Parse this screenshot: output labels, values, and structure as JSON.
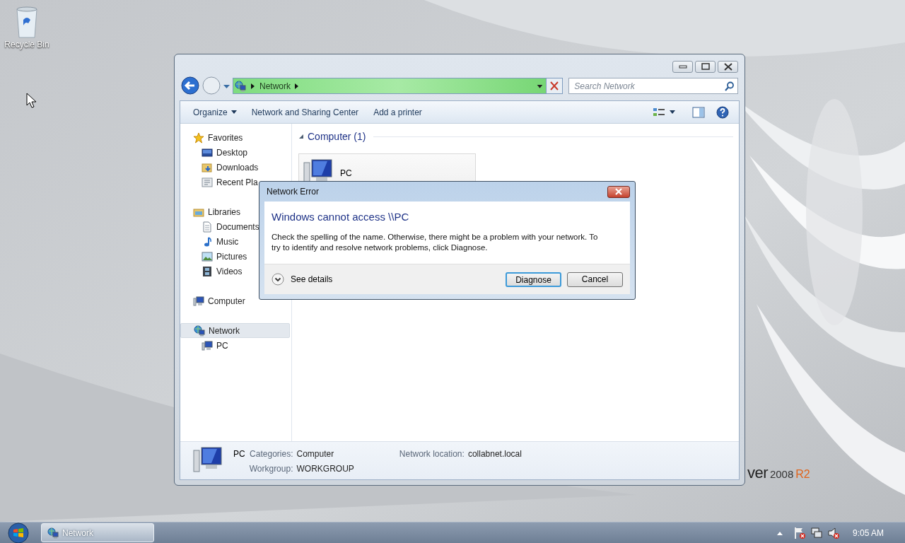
{
  "desktop": {
    "icons": [
      {
        "label": "Recycle Bin"
      }
    ],
    "wallpaper_text": [
      "ver",
      "2008",
      "R2"
    ]
  },
  "explorer": {
    "address": {
      "crumbs": [
        "Network"
      ]
    },
    "search": {
      "placeholder": "Search Network"
    },
    "toolbar": [
      {
        "label": "Organize",
        "menu": true
      },
      {
        "label": "Network and Sharing Center",
        "menu": false
      },
      {
        "label": "Add a printer",
        "menu": false
      }
    ],
    "nav": [
      {
        "label": "Favorites",
        "selected": false,
        "children": [
          {
            "label": "Desktop",
            "selected": false
          },
          {
            "label": "Downloads",
            "selected": false
          },
          {
            "label": "Recent Pla",
            "selected": false
          }
        ]
      },
      {
        "label": "Libraries",
        "selected": false,
        "children": [
          {
            "label": "Documents",
            "selected": false
          },
          {
            "label": "Music",
            "selected": false
          },
          {
            "label": "Pictures",
            "selected": false
          },
          {
            "label": "Videos",
            "selected": false
          }
        ]
      },
      {
        "label": "Computer",
        "selected": false
      },
      {
        "label": "Network",
        "selected": true,
        "children": [
          {
            "label": "PC",
            "selected": false
          }
        ]
      }
    ],
    "group": {
      "title": "Computer (1)",
      "expanded": true
    },
    "items": [
      {
        "label": "PC"
      }
    ],
    "details": {
      "name": "PC",
      "fields": [
        {
          "label": "Categories:",
          "value": "Computer"
        },
        {
          "label": "Workgroup:",
          "value": "WORKGROUP"
        },
        {
          "label": "Network location:",
          "value": "collabnet.local"
        }
      ]
    }
  },
  "dialog": {
    "title": "Network Error",
    "heading": "Windows cannot access \\\\PC",
    "message": "Check the spelling of the name. Otherwise, there might be a problem with your network. To try to identify and resolve network problems, click Diagnose.",
    "details_toggle": "See details",
    "buttons": [
      {
        "label": "Diagnose",
        "default": true
      },
      {
        "label": "Cancel",
        "default": false
      }
    ]
  },
  "taskbar": {
    "tasks": [
      {
        "label": "Network",
        "selected": true
      }
    ],
    "clock": "9:05 AM"
  }
}
